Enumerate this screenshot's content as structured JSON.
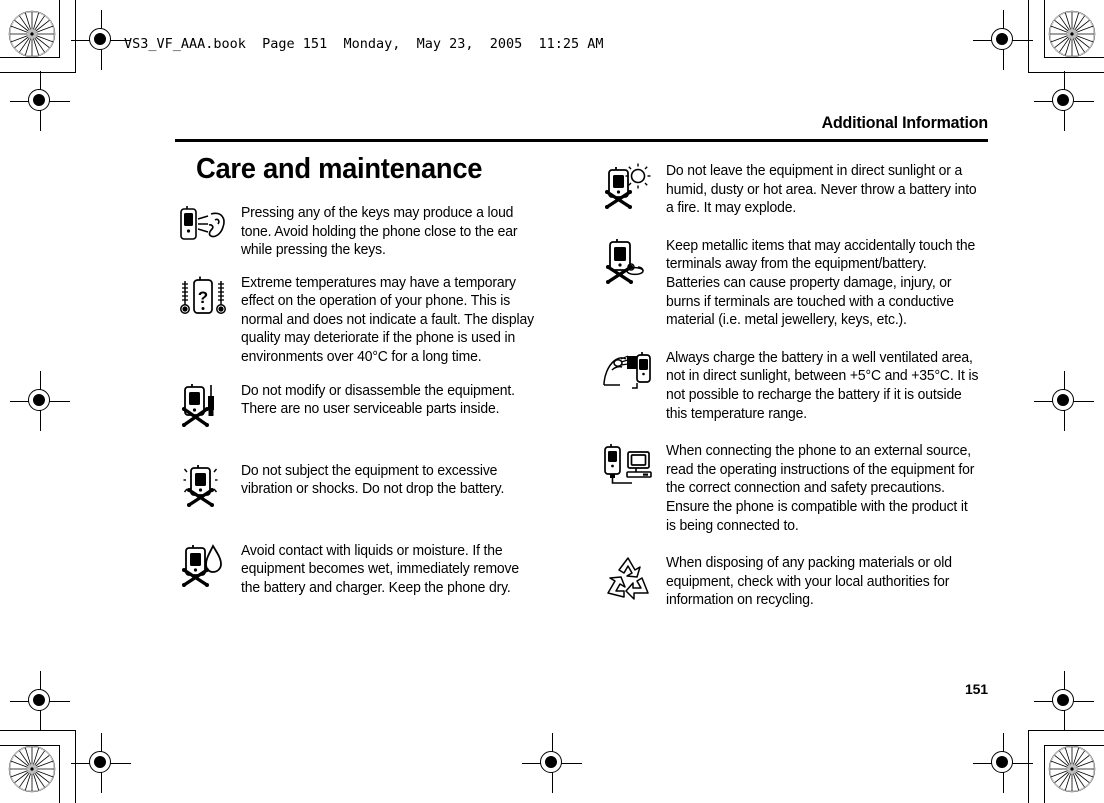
{
  "document": {
    "book_info": "VS3_VF_AAA.book  Page 151  Monday,  May 23,  2005  11:25 AM",
    "running_head": "Additional Information",
    "page_number": "151",
    "section_title": "Care and maintenance",
    "ink_color": "#000000",
    "paper_color": "#ffffff"
  },
  "left_column": {
    "items": [
      {
        "icon": "phone-loud-tone-ear-icon",
        "text": "Pressing any of the keys may produce a loud tone. Avoid holding the phone close to the ear while pressing the keys."
      },
      {
        "icon": "phone-temperature-thermometers-icon",
        "text": "Extreme temperatures may have a temporary effect on the operation of your phone. This is normal and does not indicate a fault. The display quality may deteriorate if the phone is used in environments over 40°C for a long time."
      },
      {
        "icon": "no-disassemble-phone-screwdriver-icon",
        "text": "Do not modify or disassemble the equipment. There are no user serviceable parts inside."
      },
      {
        "icon": "no-vibration-shock-phone-icon",
        "text": "Do not subject the equipment to excessive vibration or shocks. Do not drop the battery."
      },
      {
        "icon": "no-liquids-water-drop-phone-icon",
        "text": "Avoid contact with liquids or moisture. If the equipment becomes wet, immediately remove the battery and charger. Keep the phone dry."
      }
    ]
  },
  "right_column": {
    "items": [
      {
        "icon": "no-direct-sunlight-heat-phone-icon",
        "text": "Do not leave the equipment in direct sunlight or a humid, dusty or hot area. Never throw a battery into a fire. It may explode."
      },
      {
        "icon": "no-metallic-items-terminals-icon",
        "text": "Keep metallic items that may accidentally touch the terminals away from the equipment/battery. Batteries can cause property damage, injury, or burns if terminals are touched with a conductive material (i.e. metal jewellery, keys, etc.)."
      },
      {
        "icon": "charge-battery-ventilated-area-icon",
        "text": "Always charge the battery in a well ventilated area, not in direct sunlight, between +5°C and +35°C. It is not possible to recharge the battery if it is outside this temperature range."
      },
      {
        "icon": "connect-phone-external-source-icon",
        "text": "When connecting the phone to an external source, read the operating instructions of the equipment for the correct connection and safety precautions. Ensure the phone is compatible with the product it is being connected to."
      },
      {
        "icon": "recycling-arrows-icon",
        "text": "When disposing of any packing materials or old equipment, check with your local authorities for information on recycling."
      }
    ]
  },
  "print_marks": {
    "registration_marks": 8,
    "rosette_targets": 4,
    "description": "printer registration crosshairs and colour rosette targets"
  }
}
